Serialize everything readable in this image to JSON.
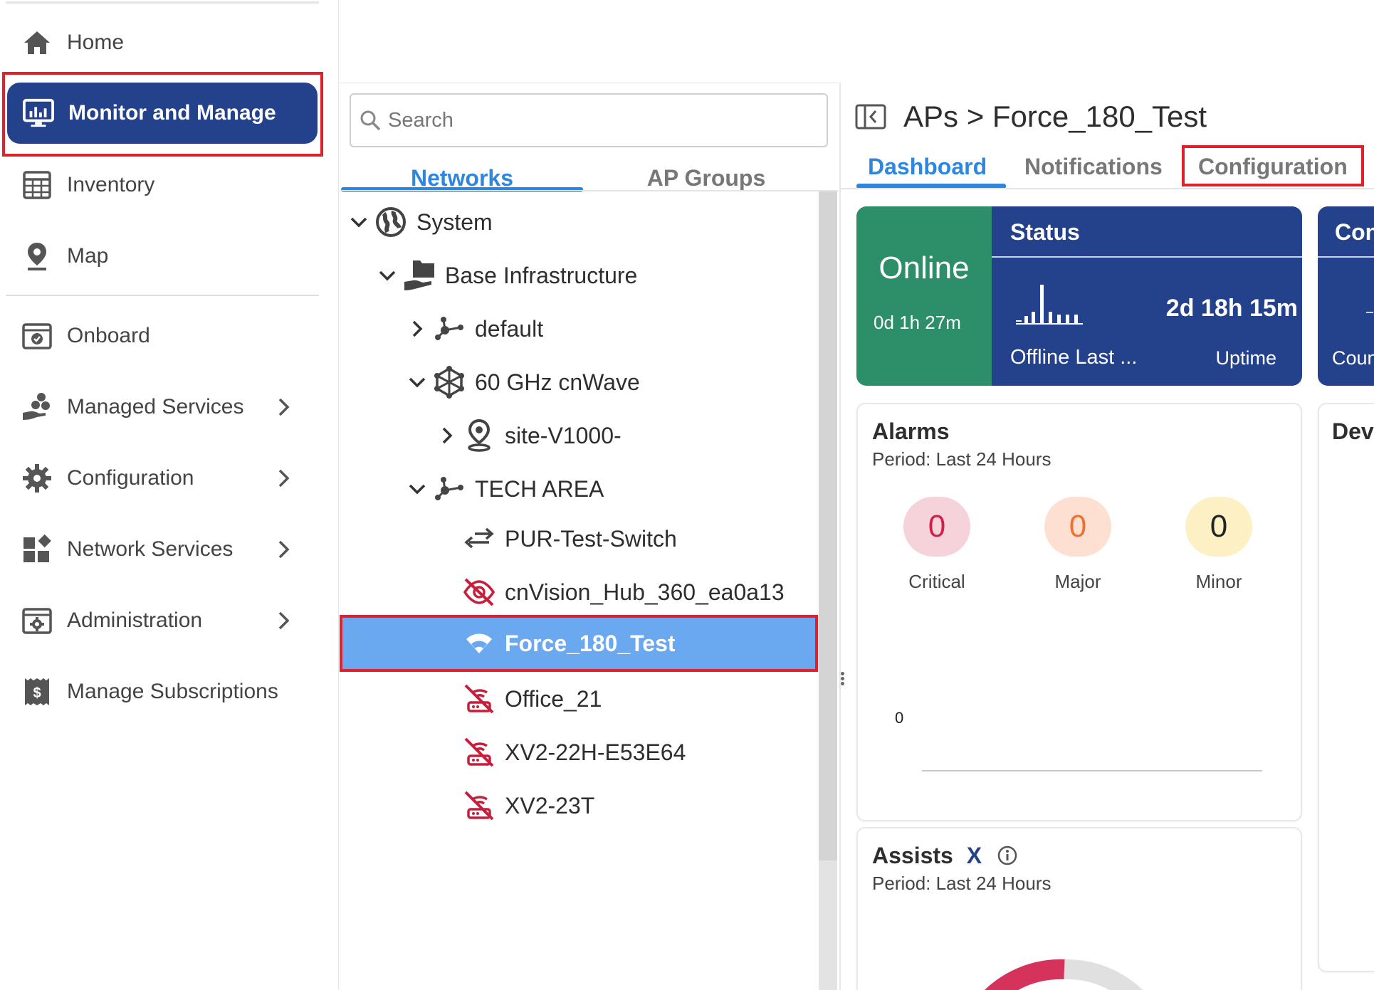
{
  "sidebar": {
    "items": [
      {
        "label": "Home",
        "icon": "home-icon"
      },
      {
        "label": "Monitor and Manage",
        "icon": "monitor-icon",
        "active": true
      },
      {
        "label": "Inventory",
        "icon": "inventory-icon"
      },
      {
        "label": "Map",
        "icon": "map-pin-icon"
      },
      {
        "label": "Onboard",
        "icon": "onboard-icon"
      },
      {
        "label": "Managed Services",
        "icon": "managed-services-icon",
        "has_children": true
      },
      {
        "label": "Configuration",
        "icon": "gear-icon",
        "has_children": true
      },
      {
        "label": "Network Services",
        "icon": "network-services-icon",
        "has_children": true
      },
      {
        "label": "Administration",
        "icon": "administration-icon",
        "has_children": true
      },
      {
        "label": "Manage Subscriptions",
        "icon": "subscription-icon"
      }
    ]
  },
  "tree": {
    "search_placeholder": "Search",
    "tabs": [
      {
        "label": "Networks",
        "active": true
      },
      {
        "label": "AP Groups",
        "active": false
      }
    ],
    "nodes": [
      {
        "label": "System",
        "icon": "globe-icon",
        "expander": "expanded"
      },
      {
        "label": "Base Infrastructure",
        "icon": "folder-hand-icon",
        "expander": "expanded"
      },
      {
        "label": "default",
        "icon": "network-nodes-icon",
        "expander": "collapsed"
      },
      {
        "label": "60 GHz cnWave",
        "icon": "cnwave-icon",
        "expander": "expanded"
      },
      {
        "label": "site-V1000-",
        "icon": "site-pin-icon",
        "expander": "collapsed"
      },
      {
        "label": "TECH AREA",
        "icon": "network-nodes-icon",
        "expander": "expanded"
      },
      {
        "label": "PUR-Test-Switch",
        "icon": "switch-arrows-icon",
        "expander": "none"
      },
      {
        "label": "cnVision_Hub_360_ea0a13",
        "icon": "offline-eye-icon",
        "expander": "none"
      },
      {
        "label": "Force_180_Test",
        "icon": "wifi-icon",
        "expander": "none",
        "selected": true
      },
      {
        "label": "Office_21",
        "icon": "offline-router-icon",
        "expander": "none"
      },
      {
        "label": "XV2-22H-E53E64",
        "icon": "offline-router-icon",
        "expander": "none"
      },
      {
        "label": "XV2-23T",
        "icon": "offline-router-icon",
        "expander": "none"
      }
    ]
  },
  "detail": {
    "breadcrumb": "APs > Force_180_Test",
    "tabs": [
      {
        "label": "Dashboard",
        "active": true
      },
      {
        "label": "Notifications",
        "active": false
      },
      {
        "label": "Configuration",
        "active": false
      }
    ],
    "status_card": {
      "state": "Online",
      "online_duration": "0d 1h 27m",
      "header": "Status",
      "uptime_value": "2d 18h 15m",
      "offline_label": "Offline Last ...",
      "uptime_label": "Uptime",
      "state_color": "#2d8f6a",
      "panel_color": "#24418b"
    },
    "partial_card": {
      "header": "Con",
      "footer": "Coun"
    },
    "alarms": {
      "title": "Alarms",
      "period": "Period: Last 24 Hours",
      "items": [
        {
          "label": "Critical",
          "value": "0",
          "bg": "#f6d3db",
          "fg": "#d0204a"
        },
        {
          "label": "Major",
          "value": "0",
          "bg": "#fde0d2",
          "fg": "#f07030"
        },
        {
          "label": "Minor",
          "value": "0",
          "bg": "#fdf0c4",
          "fg": "#222222"
        }
      ],
      "axis_value": "0"
    },
    "dev_card_title": "Dev",
    "assists": {
      "title": "Assists",
      "x_mark": "X",
      "period": "Period: Last 24 Hours"
    }
  },
  "colors": {
    "accent": "#2f86de",
    "nav_active": "#24418b",
    "selected_row": "#6aa8f0",
    "offline_red": "#c81e3c",
    "highlight_box": "#e0202a"
  }
}
